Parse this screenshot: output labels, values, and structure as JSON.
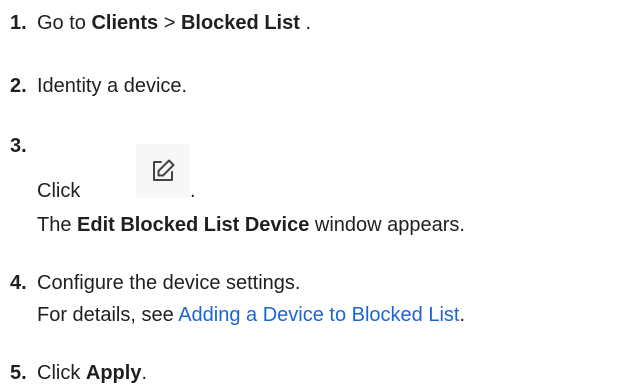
{
  "steps": [
    {
      "number": "1.",
      "text": "Go to ",
      "nav_section": "Clients",
      "separator": " > ",
      "nav_page": "Blocked List",
      "tail": " ."
    },
    {
      "number": "2.",
      "text": "Identity a device."
    },
    {
      "number": "3.",
      "click_text": "Click",
      "icon": "edit-icon",
      "click_tail": ".",
      "result_prefix": "The ",
      "window_name": "Edit Blocked List Device",
      "result_suffix": " window appears."
    },
    {
      "number": "4.",
      "text": "Configure the device settings.",
      "details_prefix": "For details, see ",
      "link_text": "Adding a Device to Blocked List",
      "details_suffix": "."
    },
    {
      "number": "5.",
      "click_text": "Click ",
      "button_name": "Apply",
      "tail": "."
    }
  ],
  "colors": {
    "text": "#1f1f1f",
    "link": "#1a66d6",
    "icon_bg": "#f7f7f7",
    "icon_stroke": "#444444"
  }
}
